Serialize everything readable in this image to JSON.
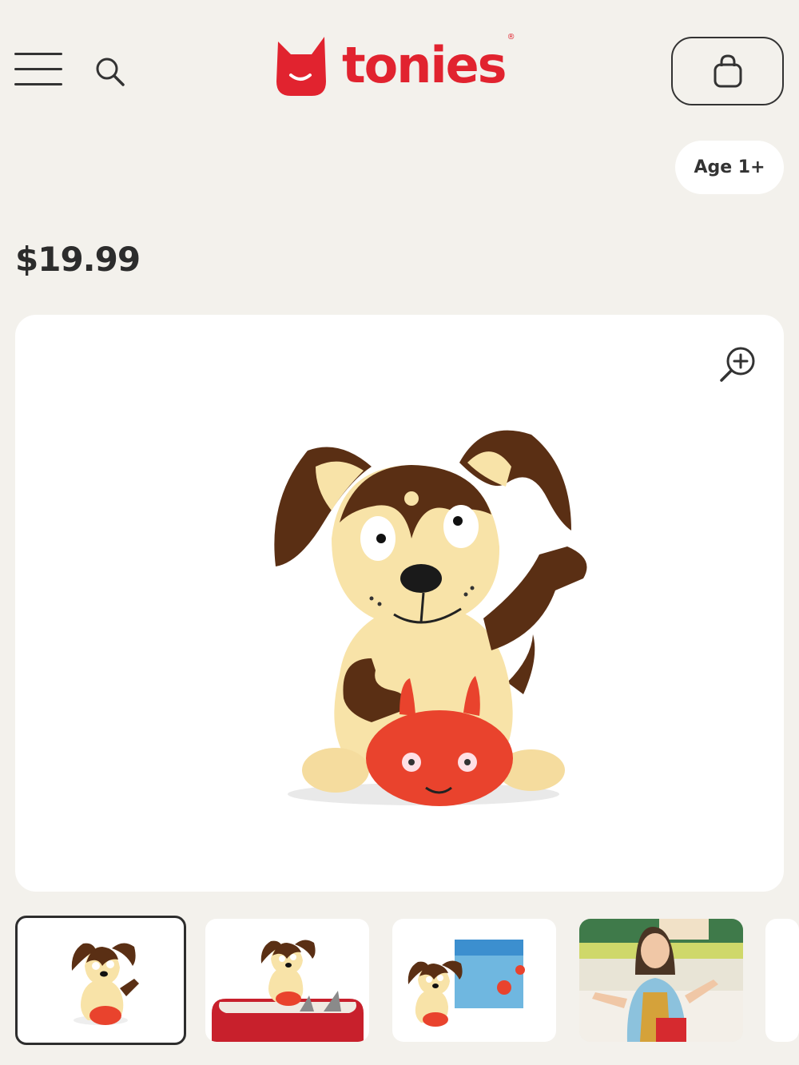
{
  "header": {
    "menu_icon": "hamburger-menu-icon",
    "search_icon": "search-icon",
    "logo_text": "tonies",
    "logo_mark": "®",
    "cart_icon": "shopping-bag-icon"
  },
  "product": {
    "age_label": "Age 1+",
    "price": "$19.99",
    "zoom_icon": "zoom-in-icon"
  },
  "thumbnails": [
    {
      "name": "figure-only",
      "selected": true
    },
    {
      "name": "figure-on-toniebox",
      "selected": false
    },
    {
      "name": "figure-with-cd-cover",
      "selected": false
    },
    {
      "name": "child-with-toniebox-photo",
      "selected": false
    },
    {
      "name": "more-thumbnail",
      "selected": false
    }
  ],
  "colors": {
    "brand_red": "#e1232f",
    "background": "#f3f1ec",
    "figure_brown": "#5a2f14",
    "figure_cream": "#f8e3a8",
    "ball_red": "#e9432d"
  }
}
